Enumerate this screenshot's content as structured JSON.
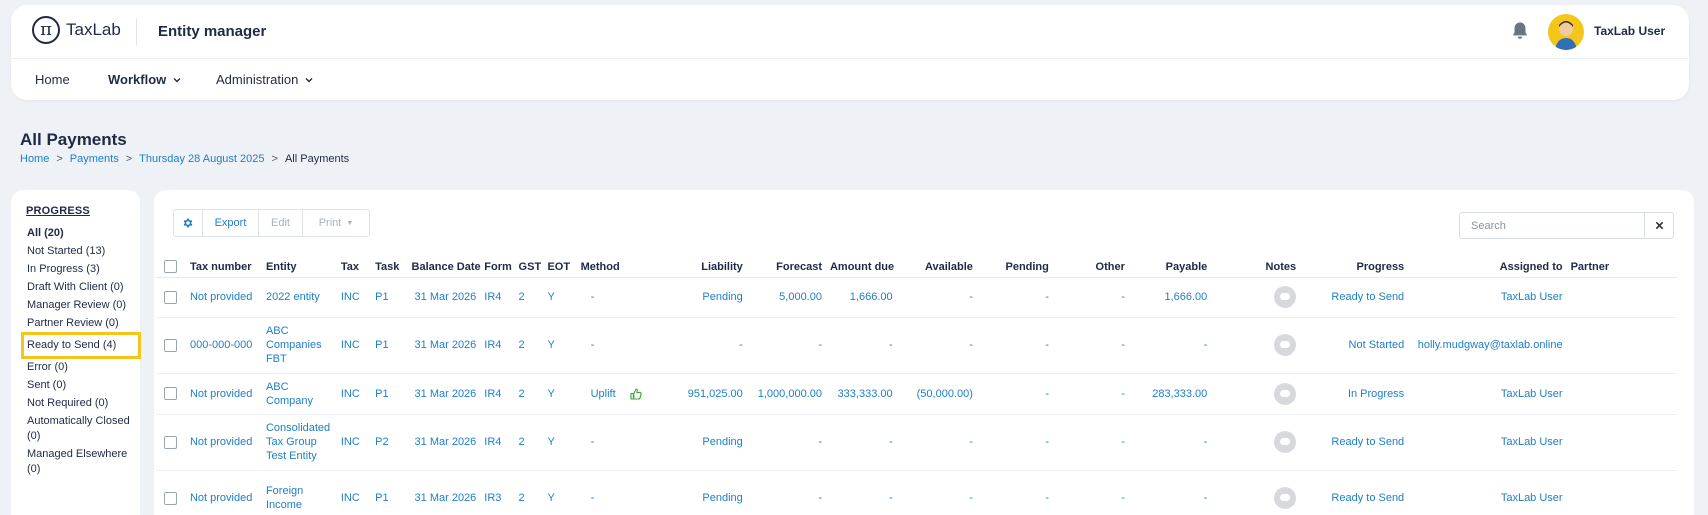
{
  "app": {
    "logo_text": "TaxLab",
    "logo_symbol": "π",
    "title": "Entity manager",
    "user_name": "TaxLab User"
  },
  "nav": {
    "home": "Home",
    "workflow": "Workflow",
    "administration": "Administration"
  },
  "page": {
    "title": "All Payments"
  },
  "breadcrumb": [
    "Home",
    "Payments",
    "Thursday 28 August 2025",
    "All Payments"
  ],
  "progress": {
    "heading": "PROGRESS",
    "items": [
      "All (20)",
      "Not Started (13)",
      "In Progress (3)",
      "Draft With Client (0)",
      "Manager Review (0)",
      "Partner Review (0)",
      "Ready to Send (4)",
      "Error (0)",
      "Sent (0)",
      "Not Required (0)",
      "Automatically Closed (0)",
      "Managed Elsewhere (0)"
    ]
  },
  "toolbar": {
    "export": "Export",
    "edit": "Edit",
    "print": "Print"
  },
  "search": {
    "placeholder": "Search"
  },
  "table": {
    "columns": [
      "Tax number",
      "Entity",
      "Tax",
      "Task",
      "Balance Date",
      "Form",
      "GST",
      "EOT",
      "Method",
      "Liability",
      "Forecast",
      "Amount due",
      "Available",
      "Pending",
      "Other",
      "Payable",
      "Notes",
      "Progress",
      "Assigned to",
      "Partner"
    ],
    "rows": [
      {
        "tax_number": "Not provided",
        "entity": "2022 entity",
        "tax": "INC",
        "task": "P1",
        "balance_date": "31 Mar 2026",
        "form": "IR4",
        "gst": "2",
        "eot": "Y",
        "method": "-",
        "liability": "Pending",
        "forecast": "5,000.00",
        "amount_due": "1,666.00",
        "available": "-",
        "pending": "-",
        "other": "-",
        "payable": "1,666.00",
        "progress": "Ready to Send",
        "assigned_to": "TaxLab User",
        "partner": ""
      },
      {
        "tax_number": "000-000-000",
        "entity": "ABC Companies FBT",
        "tax": "INC",
        "task": "P1",
        "balance_date": "31 Mar 2026",
        "form": "IR4",
        "gst": "2",
        "eot": "Y",
        "method": "-",
        "liability": "-",
        "forecast": "-",
        "amount_due": "-",
        "available": "-",
        "pending": "-",
        "other": "-",
        "payable": "-",
        "progress": "Not Started",
        "assigned_to": "holly.mudgway@taxlab.online",
        "partner": ""
      },
      {
        "tax_number": "Not provided",
        "entity": "ABC Company",
        "tax": "INC",
        "task": "P1",
        "balance_date": "31 Mar 2026",
        "form": "IR4",
        "gst": "2",
        "eot": "Y",
        "method": "Uplift",
        "liability": "951,025.00",
        "forecast": "1,000,000.00",
        "amount_due": "333,333.00",
        "available": "(50,000.00)",
        "pending": "-",
        "other": "-",
        "payable": "283,333.00",
        "progress": "In Progress",
        "assigned_to": "TaxLab User",
        "partner": ""
      },
      {
        "tax_number": "Not provided",
        "entity": "Consolidated Tax Group Test Entity",
        "tax": "INC",
        "task": "P2",
        "balance_date": "31 Mar 2026",
        "form": "IR4",
        "gst": "2",
        "eot": "Y",
        "method": "-",
        "liability": "Pending",
        "forecast": "-",
        "amount_due": "-",
        "available": "-",
        "pending": "-",
        "other": "-",
        "payable": "-",
        "progress": "Ready to Send",
        "assigned_to": "TaxLab User",
        "partner": ""
      },
      {
        "tax_number": "Not provided",
        "entity": "Foreign Income",
        "tax": "INC",
        "task": "P1",
        "balance_date": "31 Mar 2026",
        "form": "IR3",
        "gst": "2",
        "eot": "Y",
        "method": "-",
        "liability": "Pending",
        "forecast": "-",
        "amount_due": "-",
        "available": "-",
        "pending": "-",
        "other": "-",
        "payable": "-",
        "progress": "Ready to Send",
        "assigned_to": "TaxLab User",
        "partner": ""
      }
    ]
  },
  "icons": {
    "gear": "gear-icon",
    "bell": "bell-icon",
    "close": "close-icon",
    "notes": "comment-icon",
    "thumb": "thumbs-up-icon"
  },
  "colors": {
    "link": "#1e7fc4",
    "text": "#1f2a44",
    "highlight": "#f5c518",
    "thumb": "#3aaa35",
    "avatar_bg": "#f5c61a",
    "background": "#eef1f6"
  }
}
